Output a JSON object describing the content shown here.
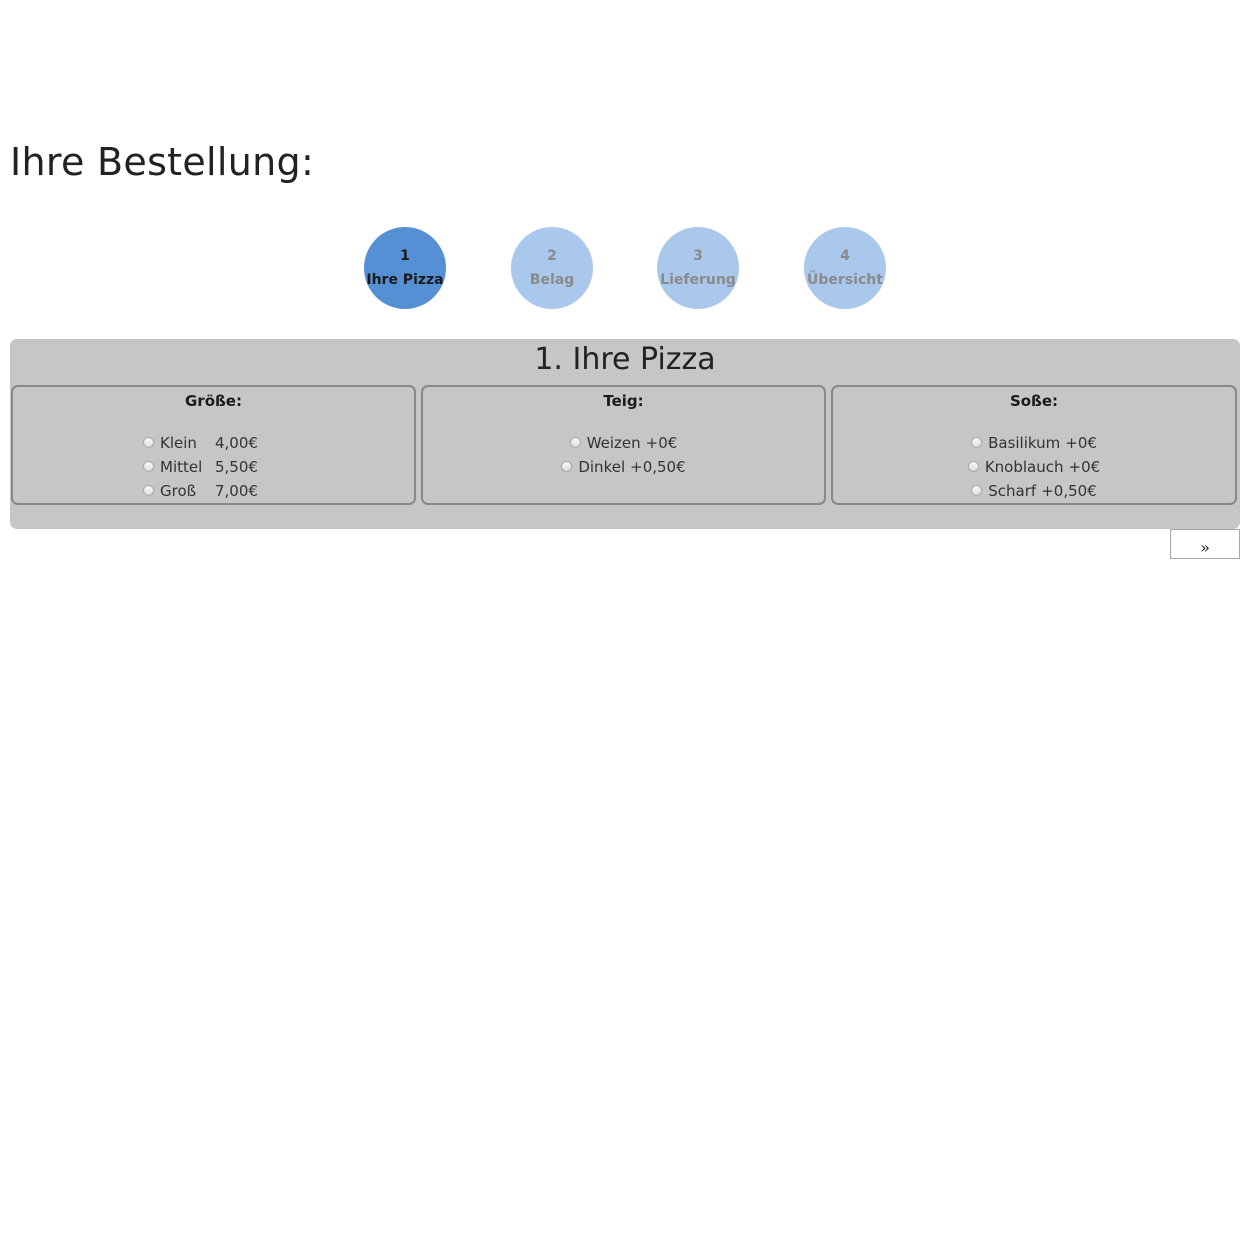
{
  "page": {
    "title": "Ihre Bestellung:"
  },
  "steps": [
    {
      "number": "1",
      "label": "Ihre Pizza",
      "active": true
    },
    {
      "number": "2",
      "label": "Belag",
      "active": false
    },
    {
      "number": "3",
      "label": "Lieferung",
      "active": false
    },
    {
      "number": "4",
      "label": "Übersicht",
      "active": false
    }
  ],
  "panel": {
    "title": "1. Ihre Pizza",
    "groups": [
      {
        "title": "Größe:",
        "options": [
          {
            "name": "Klein",
            "price": "4,00€",
            "selected": false
          },
          {
            "name": "Mittel",
            "price": "5,50€",
            "selected": false
          },
          {
            "name": "Groß",
            "price": "7,00€",
            "selected": false
          }
        ]
      },
      {
        "title": "Teig:",
        "options": [
          {
            "name": "Weizen",
            "price": "+0€",
            "selected": false
          },
          {
            "name": "Dinkel",
            "price": "+0,50€",
            "selected": false
          }
        ]
      },
      {
        "title": "Soße:",
        "options": [
          {
            "name": "Basilikum",
            "price": "+0€",
            "selected": false
          },
          {
            "name": "Knoblauch",
            "price": "+0€",
            "selected": false
          },
          {
            "name": "Scharf",
            "price": "+0,50€",
            "selected": false
          }
        ]
      }
    ]
  },
  "navigation": {
    "next_label": "»"
  },
  "colors": {
    "step_active": "#5590d4",
    "step_inactive": "#aac7ec",
    "panel_background": "#c6c6c6"
  }
}
